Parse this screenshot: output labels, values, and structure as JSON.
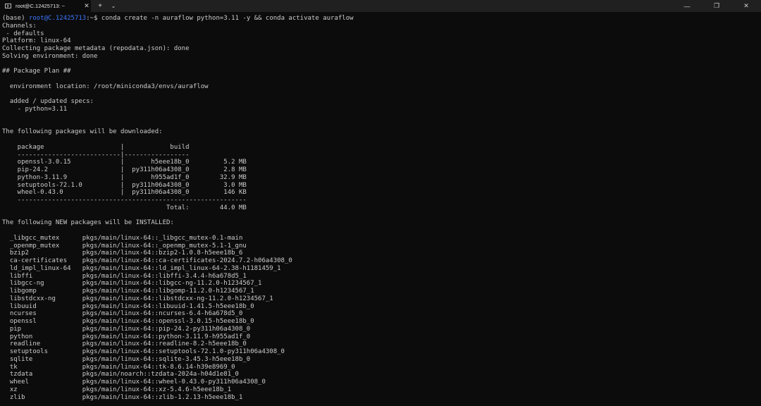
{
  "titlebar": {
    "tab_title": "root@C.12425713: ~",
    "tab_close": "✕",
    "new_tab": "+",
    "dropdown": "⌄",
    "minimize": "—",
    "maximize": "❐",
    "close": "✕"
  },
  "prompt": {
    "env": "(base) ",
    "user": "root",
    "at_host": "@C.12425713",
    "path_symbol": ":~$ ",
    "command": "conda create -n auraflow python=3.11 -y && conda activate auraflow"
  },
  "output": [
    "Channels:",
    " - defaults",
    "Platform: linux-64",
    "Collecting package metadata (repodata.json): done",
    "Solving environment: done",
    "",
    "## Package Plan ##",
    "",
    "  environment location: /root/miniconda3/envs/auraflow",
    "",
    "  added / updated specs:",
    "    - python=3.11",
    "",
    "",
    "The following packages will be downloaded:",
    "",
    "    package                    |            build",
    "    ---------------------------|-----------------",
    "    openssl-3.0.15             |       h5eee18b_0         5.2 MB",
    "    pip-24.2                   |  py311h06a4308_0         2.8 MB",
    "    python-3.11.9              |       h955ad1f_0        32.9 MB",
    "    setuptools-72.1.0          |  py311h06a4308_0         3.0 MB",
    "    wheel-0.43.0               |  py311h06a4308_0         146 KB",
    "    ------------------------------------------------------------",
    "                                           Total:        44.0 MB",
    "",
    "The following NEW packages will be INSTALLED:",
    "",
    "  _libgcc_mutex      pkgs/main/linux-64::_libgcc_mutex-0.1-main",
    "  _openmp_mutex      pkgs/main/linux-64::_openmp_mutex-5.1-1_gnu",
    "  bzip2              pkgs/main/linux-64::bzip2-1.0.8-h5eee18b_6",
    "  ca-certificates    pkgs/main/linux-64::ca-certificates-2024.7.2-h06a4308_0",
    "  ld_impl_linux-64   pkgs/main/linux-64::ld_impl_linux-64-2.38-h1181459_1",
    "  libffi             pkgs/main/linux-64::libffi-3.4.4-h6a678d5_1",
    "  libgcc-ng          pkgs/main/linux-64::libgcc-ng-11.2.0-h1234567_1",
    "  libgomp            pkgs/main/linux-64::libgomp-11.2.0-h1234567_1",
    "  libstdcxx-ng       pkgs/main/linux-64::libstdcxx-ng-11.2.0-h1234567_1",
    "  libuuid            pkgs/main/linux-64::libuuid-1.41.5-h5eee18b_0",
    "  ncurses            pkgs/main/linux-64::ncurses-6.4-h6a678d5_0",
    "  openssl            pkgs/main/linux-64::openssl-3.0.15-h5eee18b_0",
    "  pip                pkgs/main/linux-64::pip-24.2-py311h06a4308_0",
    "  python             pkgs/main/linux-64::python-3.11.9-h955ad1f_0",
    "  readline           pkgs/main/linux-64::readline-8.2-h5eee18b_0",
    "  setuptools         pkgs/main/linux-64::setuptools-72.1.0-py311h06a4308_0",
    "  sqlite             pkgs/main/linux-64::sqlite-3.45.3-h5eee18b_0",
    "  tk                 pkgs/main/linux-64::tk-8.6.14-h39e8969_0",
    "  tzdata             pkgs/main/noarch::tzdata-2024a-h04d1e81_0",
    "  wheel              pkgs/main/linux-64::wheel-0.43.0-py311h06a4308_0",
    "  xz                 pkgs/main/linux-64::xz-5.4.6-h5eee18b_1",
    "  zlib               pkgs/main/linux-64::zlib-1.2.13-h5eee18b_1"
  ]
}
